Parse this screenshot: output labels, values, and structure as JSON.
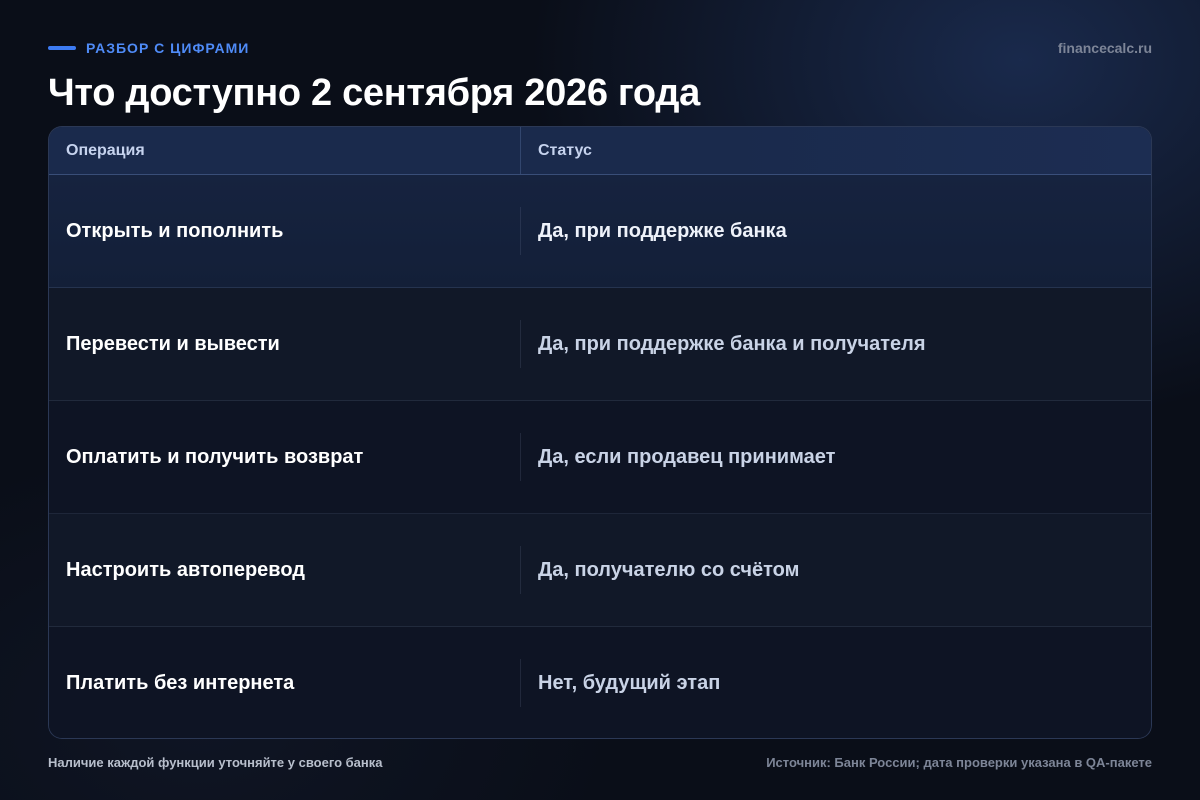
{
  "header": {
    "kicker": "РАЗБОР С ЦИФРАМИ",
    "site": "financecalc.ru",
    "title": "Что доступно 2 сентября 2026 года"
  },
  "table": {
    "columns": [
      "Операция",
      "Статус"
    ],
    "rows": [
      {
        "operation": "Открыть и пополнить",
        "status": "Да, при поддержке банка"
      },
      {
        "operation": "Перевести и вывести",
        "status": "Да, при поддержке банка и получателя"
      },
      {
        "operation": "Оплатить и получить возврат",
        "status": "Да, если продавец принимает"
      },
      {
        "operation": "Настроить автоперевод",
        "status": "Да, получателю со счётом"
      },
      {
        "operation": "Платить без интернета",
        "status": "Нет, будущий этап"
      }
    ]
  },
  "footer": {
    "note": "Наличие каждой функции уточняйте у своего банка",
    "source": "Источник: Банк России; дата проверки указана в QA-пакете"
  },
  "colors": {
    "accent": "#3d7bf2",
    "background": "#0a0e18",
    "header_row": "#1a2a4c"
  }
}
